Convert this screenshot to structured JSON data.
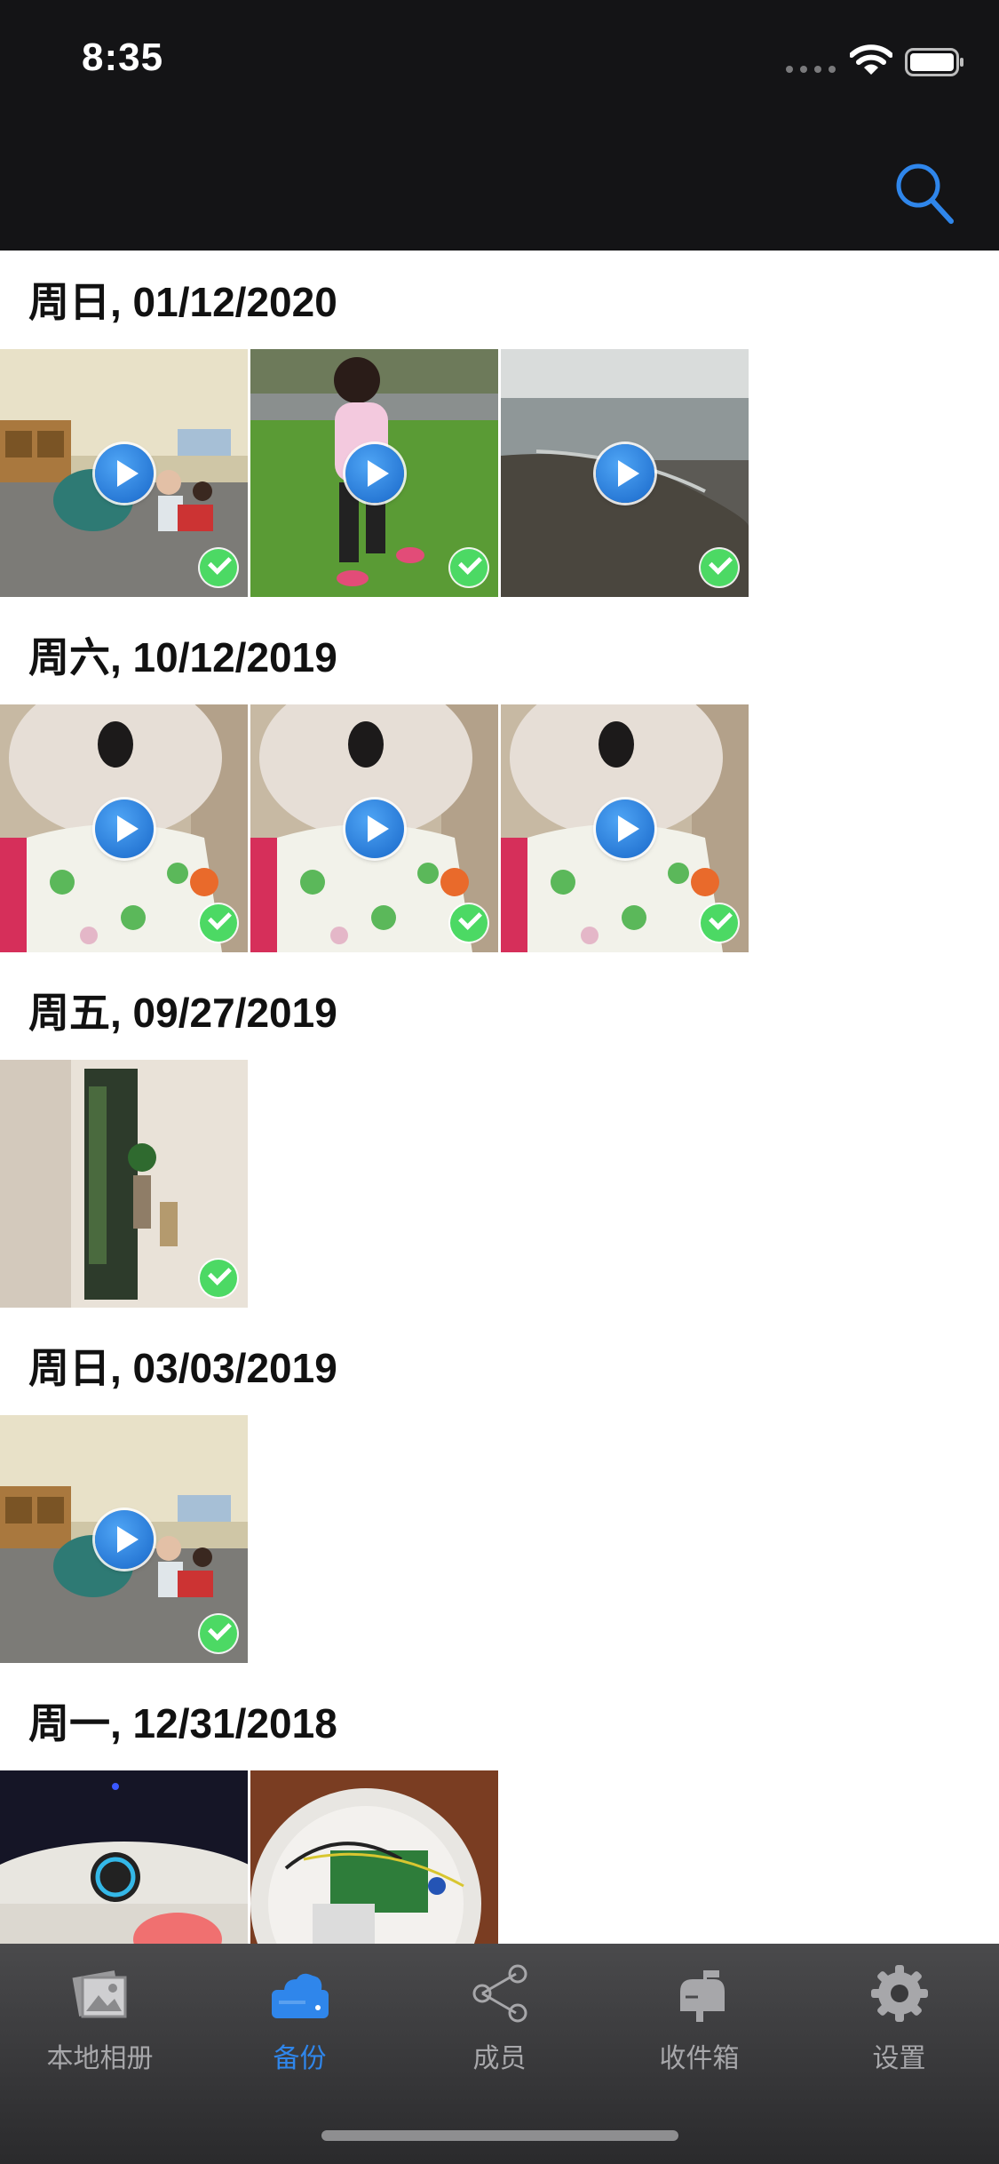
{
  "status_bar": {
    "time": "8:35"
  },
  "header": {
    "search_icon": "search-icon",
    "accent": "#2f86eb"
  },
  "sections": [
    {
      "date": "周日, 01/12/2020",
      "items": [
        {
          "scene": "classroom",
          "video": true,
          "backed_up": true
        },
        {
          "scene": "girl-grass",
          "video": true,
          "backed_up": true
        },
        {
          "scene": "beach",
          "video": true,
          "backed_up": true
        }
      ]
    },
    {
      "date": "周六, 10/12/2019",
      "items": [
        {
          "scene": "costume",
          "video": true,
          "backed_up": true
        },
        {
          "scene": "costume",
          "video": true,
          "backed_up": true
        },
        {
          "scene": "costume",
          "video": true,
          "backed_up": true
        }
      ]
    },
    {
      "date": "周五, 09/27/2019",
      "items": [
        {
          "scene": "circuit",
          "video": false,
          "backed_up": true
        }
      ]
    },
    {
      "date": "周日, 03/03/2019",
      "items": [
        {
          "scene": "classroom",
          "video": true,
          "backed_up": true
        }
      ]
    },
    {
      "date": "周一, 12/31/2018",
      "items": [
        {
          "scene": "button",
          "video": false,
          "backed_up": false
        },
        {
          "scene": "raspberry",
          "video": false,
          "backed_up": false
        }
      ]
    }
  ],
  "tabs": [
    {
      "label": "本地相册",
      "icon": "photos-icon",
      "active": false
    },
    {
      "label": "备份",
      "icon": "cloud-drive-icon",
      "active": true
    },
    {
      "label": "成员",
      "icon": "share-icon",
      "active": false
    },
    {
      "label": "收件箱",
      "icon": "mailbox-icon",
      "active": false
    },
    {
      "label": "设置",
      "icon": "gear-icon",
      "active": false
    }
  ],
  "colors": {
    "check": "#4cd964",
    "play": "#1f74d6",
    "tab_inactive": "#a7a7aa"
  }
}
